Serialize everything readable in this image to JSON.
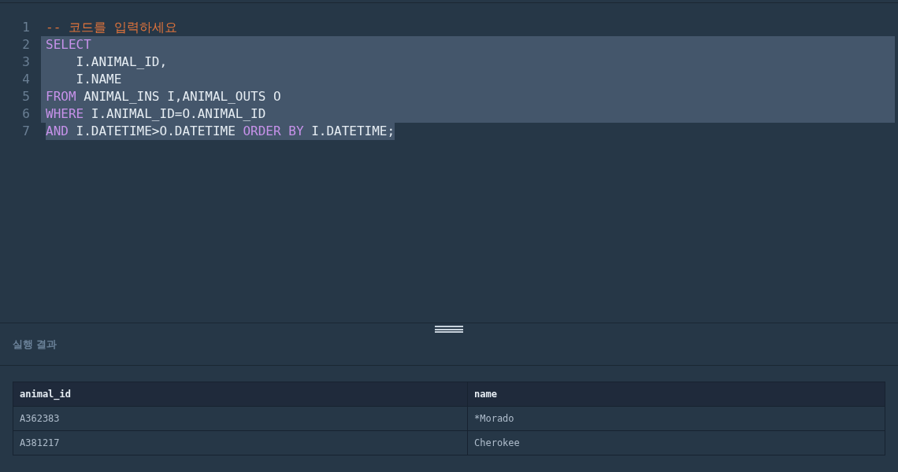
{
  "editor": {
    "lines": [
      {
        "number": "1",
        "selected": false,
        "tokens": [
          {
            "kind": "comment",
            "text": "-- 코드를 입력하세요"
          }
        ]
      },
      {
        "number": "2",
        "selected": true,
        "tokens": [
          {
            "kind": "keyword",
            "text": "SELECT"
          }
        ]
      },
      {
        "number": "3",
        "selected": true,
        "tokens": [
          {
            "kind": "plain",
            "text": "    I.ANIMAL_ID,"
          }
        ]
      },
      {
        "number": "4",
        "selected": true,
        "tokens": [
          {
            "kind": "plain",
            "text": "    I.NAME"
          }
        ]
      },
      {
        "number": "5",
        "selected": true,
        "tokens": [
          {
            "kind": "keyword",
            "text": "FROM"
          },
          {
            "kind": "plain",
            "text": " ANIMAL_INS I,ANIMAL_OUTS O"
          }
        ]
      },
      {
        "number": "6",
        "selected": true,
        "tokens": [
          {
            "kind": "keyword",
            "text": "WHERE"
          },
          {
            "kind": "plain",
            "text": " I.ANIMAL_ID=O.ANIMAL_ID"
          }
        ]
      },
      {
        "number": "7",
        "selected": true,
        "tokens": [
          {
            "kind": "keyword",
            "text": "AND"
          },
          {
            "kind": "plain",
            "text": " I.DATETIME>O.DATETIME "
          },
          {
            "kind": "keyword",
            "text": "ORDER BY"
          },
          {
            "kind": "plain",
            "text": " I.DATETIME;"
          }
        ]
      }
    ]
  },
  "results": {
    "title": "실행 결과",
    "table": {
      "columns": [
        "animal_id",
        "name"
      ],
      "rows": [
        [
          "A362383",
          "*Morado"
        ],
        [
          "A381217",
          "Cherokee"
        ]
      ]
    }
  }
}
